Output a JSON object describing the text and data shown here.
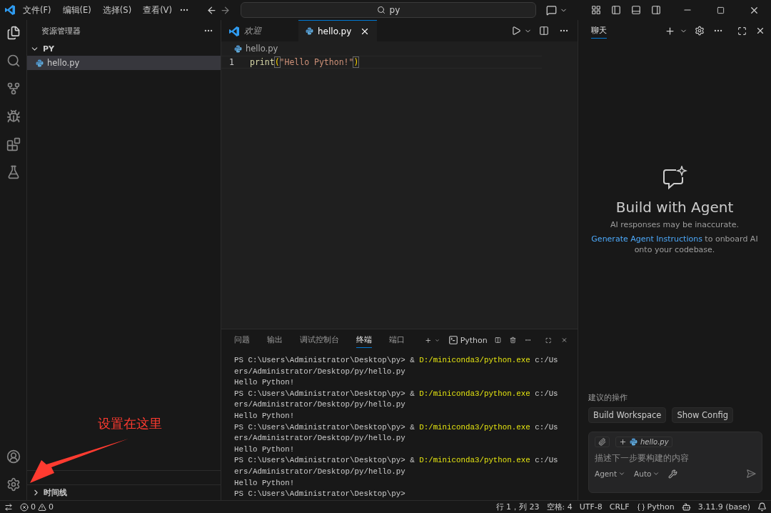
{
  "menu": [
    "文件(F)",
    "编辑(E)",
    "选择(S)",
    "查看(V)"
  ],
  "search": {
    "value": "py"
  },
  "sidebar": {
    "title": "资源管理器",
    "folder": {
      "label": "PY",
      "expanded": true,
      "children": [
        {
          "label": "hello.py",
          "selected": true
        }
      ]
    },
    "sections": [
      {
        "label": "时间线",
        "expanded": false
      }
    ]
  },
  "editor": {
    "tabs": [
      {
        "label": "欢迎",
        "selected": false,
        "kind": "welcome"
      },
      {
        "label": "hello.py",
        "selected": true,
        "kind": "python"
      }
    ],
    "breadcrumb": "hello.py",
    "lines": [
      {
        "number": "1",
        "tokens": [
          {
            "text": "print",
            "kind": "function"
          },
          {
            "text": "(",
            "kind": "bracket"
          },
          {
            "text": "\"Hello Python!\"",
            "kind": "string"
          },
          {
            "text": ")",
            "kind": "bracket"
          }
        ]
      }
    ]
  },
  "panel": {
    "tabs": [
      {
        "label": "问题",
        "selected": false
      },
      {
        "label": "输出",
        "selected": false
      },
      {
        "label": "调试控制台",
        "selected": false
      },
      {
        "label": "终端",
        "selected": true
      },
      {
        "label": "端口",
        "selected": false
      }
    ],
    "terminal_name": "Python",
    "lines": [
      {
        "kind": "command",
        "prompt": "PS C:\\Users\\Administrator\\Desktop\\py>",
        "op": "&",
        "exe": "D:/miniconda3/python.exe",
        "args": "c:/Us"
      },
      {
        "kind": "text",
        "text": "ers/Administrator/Desktop/py/hello.py"
      },
      {
        "kind": "text",
        "text": "Hello Python!"
      },
      {
        "kind": "command",
        "prompt": "PS C:\\Users\\Administrator\\Desktop\\py>",
        "op": "&",
        "exe": "D:/miniconda3/python.exe",
        "args": "c:/Us"
      },
      {
        "kind": "text",
        "text": "ers/Administrator/Desktop/py/hello.py"
      },
      {
        "kind": "text",
        "text": "Hello Python!"
      },
      {
        "kind": "command",
        "prompt": "PS C:\\Users\\Administrator\\Desktop\\py>",
        "op": "&",
        "exe": "D:/miniconda3/python.exe",
        "args": "c:/Us"
      },
      {
        "kind": "text",
        "text": "ers/Administrator/Desktop/py/hello.py"
      },
      {
        "kind": "text",
        "text": "Hello Python!"
      },
      {
        "kind": "command",
        "prompt": "PS C:\\Users\\Administrator\\Desktop\\py>",
        "op": "&",
        "exe": "D:/miniconda3/python.exe",
        "args": "c:/Us"
      },
      {
        "kind": "text",
        "text": "ers/Administrator/Desktop/py/hello.py"
      },
      {
        "kind": "text",
        "text": "Hello Python!"
      },
      {
        "kind": "text",
        "text": "PS C:\\Users\\Administrator\\Desktop\\py>"
      }
    ]
  },
  "chat": {
    "tabs": [
      {
        "label": "聊天",
        "selected": true
      }
    ],
    "title": "Build with Agent",
    "disclaimer": "AI responses may be inaccurate.",
    "link": "Generate Agent Instructions",
    "after_link": " to onboard AI onto your codebase.",
    "suggestions_title": "建议的操作",
    "suggestions": [
      "Build Workspace",
      "Show Config"
    ],
    "attachment": "hello.py",
    "placeholder": "描述下一步要构建的内容",
    "mode": "Agent",
    "model": "Auto"
  },
  "status_bar": {
    "errors": "0",
    "warnings": "0",
    "position": "行 1，列 23",
    "indent": "空格: 4",
    "encoding": "UTF-8",
    "eol": "CRLF",
    "language": "Python",
    "interpreter": "3.11.9 (base)"
  },
  "annotation": {
    "text": "设置在这里"
  }
}
